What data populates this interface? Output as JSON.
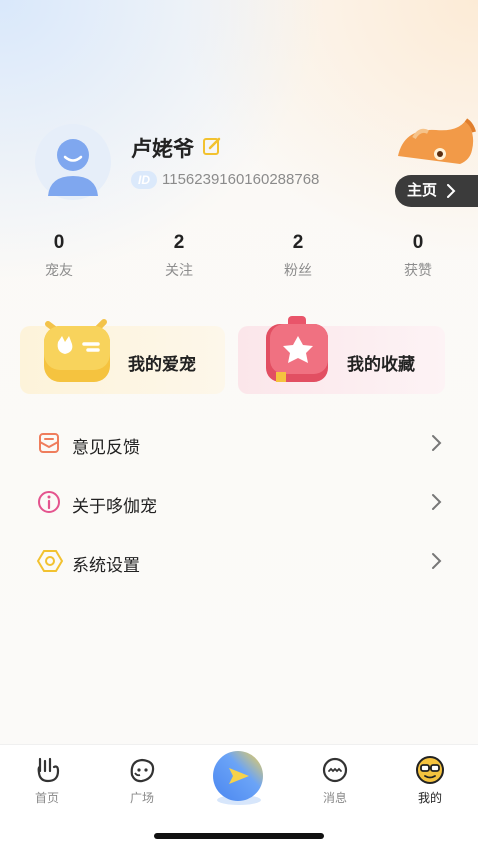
{
  "profile": {
    "nickname": "卢姥爷",
    "id_badge": "ID",
    "id_number": "1156239160160288768",
    "homepage_label": "主页"
  },
  "stats": [
    {
      "value": "0",
      "label": "宠友"
    },
    {
      "value": "2",
      "label": "关注"
    },
    {
      "value": "2",
      "label": "粉丝"
    },
    {
      "value": "0",
      "label": "获赞"
    }
  ],
  "cards": {
    "pet": {
      "label": "我的爱宠",
      "icon": "pet-box-icon"
    },
    "favorites": {
      "label": "我的收藏",
      "icon": "favorites-book-icon"
    }
  },
  "menu": [
    {
      "label": "意见反馈",
      "icon": "feedback-icon"
    },
    {
      "label": "关于哆伽宠",
      "icon": "info-icon"
    },
    {
      "label": "系统设置",
      "icon": "settings-icon"
    }
  ],
  "tabs": [
    {
      "label": "首页",
      "icon": "home-hand-icon"
    },
    {
      "label": "广场",
      "icon": "square-face-icon"
    },
    {
      "label": "",
      "icon": "publish-icon"
    },
    {
      "label": "消息",
      "icon": "message-icon"
    },
    {
      "label": "我的",
      "icon": "mine-face-icon"
    }
  ],
  "colors": {
    "accent_yellow": "#f5c842",
    "accent_pink": "#ea5d6d",
    "dark_button": "#3b3b3b"
  }
}
